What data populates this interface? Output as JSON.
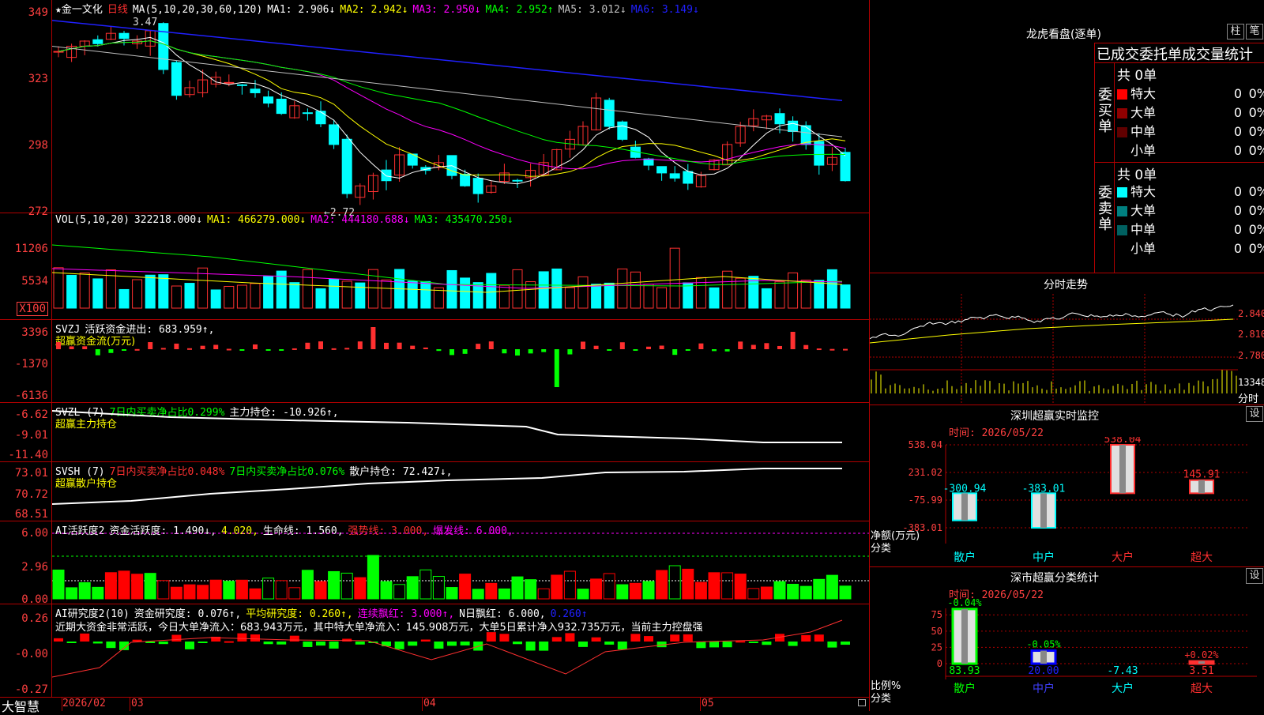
{
  "main": {
    "indicator_line": [
      {
        "t": "★金一文化",
        "c": "#ffffff"
      },
      {
        "t": "日线",
        "c": "#ff3030"
      },
      {
        "t": "MA(5,10,20,30,60,120)",
        "c": "#ffffff"
      },
      {
        "t": "MA1: 2.906↓",
        "c": "#ffffff"
      },
      {
        "t": "MA2: 2.942↓",
        "c": "#ffff00"
      },
      {
        "t": "MA3: 2.950↓",
        "c": "#ff00ff"
      },
      {
        "t": "MA4: 2.952↑",
        "c": "#00ff00"
      },
      {
        "t": "MA5: 3.012↓",
        "c": "#c0c0c0"
      },
      {
        "t": "MA6: 3.149↓",
        "c": "#2020ff"
      }
    ],
    "y_ticks": [
      "349",
      "323",
      "298",
      "272"
    ],
    "high_label": "3.47",
    "low_label": "←2.72"
  },
  "vol": {
    "indicator_line": [
      {
        "t": "VOL(5,10,20)",
        "c": "#ffffff"
      },
      {
        "t": "322218.000↓",
        "c": "#ffffff"
      },
      {
        "t": "MA1: 466279.000↓",
        "c": "#ffff00"
      },
      {
        "t": "MA2: 444180.688↓",
        "c": "#ff00ff"
      },
      {
        "t": "MA3: 435470.250↓",
        "c": "#00ff00"
      }
    ],
    "y_ticks": [
      "11206",
      "5534"
    ],
    "unit": "X100"
  },
  "svzj": {
    "indicator_line": [
      {
        "t": "SVZJ",
        "c": "#ffffff"
      },
      {
        "t": "活跃资金进出: 683.959↑,",
        "c": "#ffffff"
      }
    ],
    "sub": "超赢资金流(万元)",
    "y_ticks": [
      "3396",
      "-1370",
      "-6136"
    ]
  },
  "svzl": {
    "indicator_line": [
      {
        "t": "SVZL (7)",
        "c": "#ffffff"
      },
      {
        "t": "7日内买卖净占比0.299%",
        "c": "#00ff00"
      },
      {
        "t": "主力持仓: -10.926↑,",
        "c": "#ffffff"
      }
    ],
    "sub": "超赢主力持仓",
    "y_ticks": [
      "-6.62",
      "-9.01",
      "-11.40"
    ]
  },
  "svsh": {
    "indicator_line": [
      {
        "t": "SVSH (7)",
        "c": "#ffffff"
      },
      {
        "t": "7日内买卖净占比0.048%",
        "c": "#ff3030"
      },
      {
        "t": "7日内买卖净占比0.076%",
        "c": "#00ff00"
      },
      {
        "t": "散户持仓: 72.427↓,",
        "c": "#ffffff"
      }
    ],
    "sub": "超赢散户持仓",
    "y_ticks": [
      "73.01",
      "70.72",
      "68.51"
    ]
  },
  "ai1": {
    "indicator_line": [
      {
        "t": "AI活跃度2",
        "c": "#ffffff"
      },
      {
        "t": "资金活跃度: 1.490↓,",
        "c": "#ffffff"
      },
      {
        "t": "4.020,",
        "c": "#ffff00"
      },
      {
        "t": "生命线: 1.560,",
        "c": "#ffffff"
      },
      {
        "t": "强势线: 3.000,",
        "c": "#ff3030"
      },
      {
        "t": "爆发线: 6.000,",
        "c": "#ff00ff"
      }
    ],
    "y_ticks": [
      "6.00",
      "2.96",
      "0.00"
    ]
  },
  "ai2": {
    "indicator_line": [
      {
        "t": "AI研究度2(10)",
        "c": "#ffffff"
      },
      {
        "t": "资金研究度: 0.076↑,",
        "c": "#ffffff"
      },
      {
        "t": "平均研究度: 0.260↑,",
        "c": "#ffff00"
      },
      {
        "t": "连续飘红: 3.000↑,",
        "c": "#ff00ff"
      },
      {
        "t": "N日飘红: 6.000,",
        "c": "#ffffff"
      },
      {
        "t": "0.260↑",
        "c": "#2020ff"
      }
    ],
    "comment": "近期大资金非常活跃，今日大单净流入：683.943万元，其中特大单净流入：145.908万元，大单5日累计净入932.735万元，当前主力控盘强",
    "y_ticks": [
      "0.26",
      "-0.00",
      "-0.27"
    ]
  },
  "bottom_axis": {
    "brand": "大智慧",
    "labels": [
      "2026/02",
      "03",
      "04",
      "05"
    ]
  },
  "lhb": {
    "title": "龙虎看盘(逐单)",
    "btn_bar": "柱",
    "btn_pen": "笔",
    "header": "已成交委托单成交量统计",
    "buy_label": "委买单",
    "sell_label": "委卖单",
    "buy_total": "共 0单",
    "sell_total": "共 0单",
    "buy_rows": [
      {
        "name": "特大",
        "count": "0",
        "pct": "0%",
        "color": "#ff0000"
      },
      {
        "name": "大单",
        "count": "0",
        "pct": "0%",
        "color": "#900000"
      },
      {
        "name": "中单",
        "count": "0",
        "pct": "0%",
        "color": "#600000"
      },
      {
        "name": "小单",
        "count": "0",
        "pct": "0%",
        "color": ""
      }
    ],
    "sell_rows": [
      {
        "name": "特大",
        "count": "0",
        "pct": "0%",
        "color": "#00ffff"
      },
      {
        "name": "大单",
        "count": "0",
        "pct": "0%",
        "color": "#008080"
      },
      {
        "name": "中单",
        "count": "0",
        "pct": "0%",
        "color": "#006060"
      },
      {
        "name": "小单",
        "count": "0",
        "pct": "0%",
        "color": ""
      }
    ]
  },
  "fenshi": {
    "title": "分时走势",
    "price_ticks": [
      "2.840",
      "2.810",
      "2.780"
    ],
    "vol_tick": "13348",
    "label": "分时"
  },
  "sz_monitor": {
    "title": "深圳超赢实时监控",
    "btn": "设",
    "time": "时间: 2026/05/22",
    "y_ticks": [
      "538.04",
      "231.02",
      "-75.99",
      "-383.01"
    ],
    "y_label": "净额(万元)",
    "x_label": "分类",
    "chart_data": {
      "type": "bar",
      "categories": [
        "散户",
        "中户",
        "大户",
        "超大"
      ],
      "values": [
        -300.94,
        -383.01,
        538.04,
        145.91
      ],
      "value_labels": [
        "-300.94",
        "-383.01",
        "538.04",
        "145.91"
      ],
      "ylabel": "净额(万元)",
      "xlabel": "分类",
      "ylim": [
        -383.01,
        538.04
      ]
    }
  },
  "sz_class": {
    "title": "深市超赢分类统计",
    "btn": "设",
    "time": "时间: 2026/05/22",
    "y_ticks": [
      "75",
      "50",
      "25",
      "0"
    ],
    "y_label": "比例%",
    "x_label": "分类",
    "chart_data": {
      "type": "bar",
      "categories": [
        "散户",
        "中户",
        "大户",
        "超大"
      ],
      "values": [
        83.93,
        20.0,
        -7.43,
        3.51
      ],
      "change_labels": [
        "-0.04%",
        "-0.05%",
        "",
        "+0.02%"
      ],
      "value_labels": [
        "83.93",
        "20.00",
        "-7.43",
        "3.51"
      ],
      "ylabel": "比例%",
      "xlabel": "分类",
      "ylim": [
        0,
        85
      ]
    }
  }
}
